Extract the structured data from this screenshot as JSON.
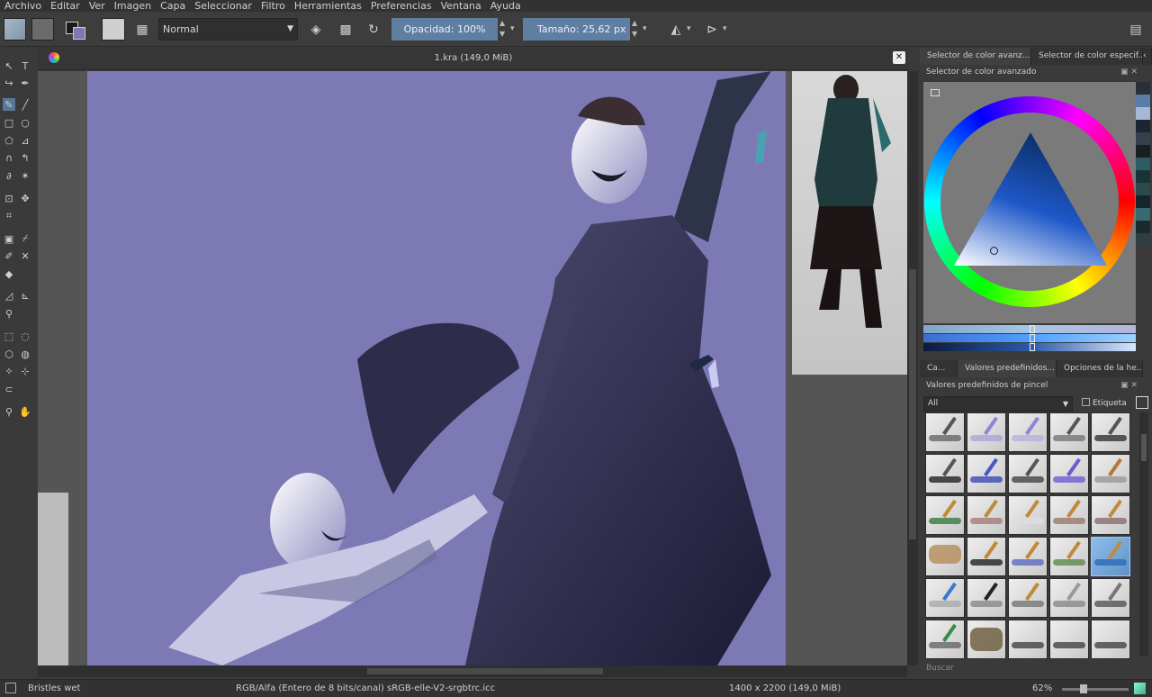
{
  "menu": [
    "Archivo",
    "Editar",
    "Ver",
    "Imagen",
    "Capa",
    "Seleccionar",
    "Filtro",
    "Herramientas",
    "Preferencias",
    "Ventana",
    "Ayuda"
  ],
  "toolbar": {
    "blend_mode": "Normal",
    "opacity_label": "Opacidad:  100%",
    "size_label": "Tamaño:  25,62 px"
  },
  "document": {
    "title": "1.kra (149,0 MiB)"
  },
  "colors": {
    "canvas_background": "#7d79b4",
    "accent": "#5f7fa1"
  },
  "right_panel": {
    "top_tabs": [
      "Selector de color avanz...",
      "Selector de color especif..."
    ],
    "color_selector_title": "Selector de color avanzado",
    "lower_tabs": [
      "Ca...",
      "Valores predefinidos...",
      "Opciones de la he..."
    ],
    "presets_title": "Valores predefinidos de pincel",
    "filter_value": "All",
    "tag_label": "Etiqueta",
    "search_placeholder": "Buscar"
  },
  "status": {
    "brush": "Bristles wet",
    "color_space": "RGB/Alfa (Entero de 8 bits/canal)  sRGB-elle-V2-srgbtrc.icc",
    "dimensions": "1400 x 2200 (149,0 MiB)",
    "zoom": "62%"
  }
}
